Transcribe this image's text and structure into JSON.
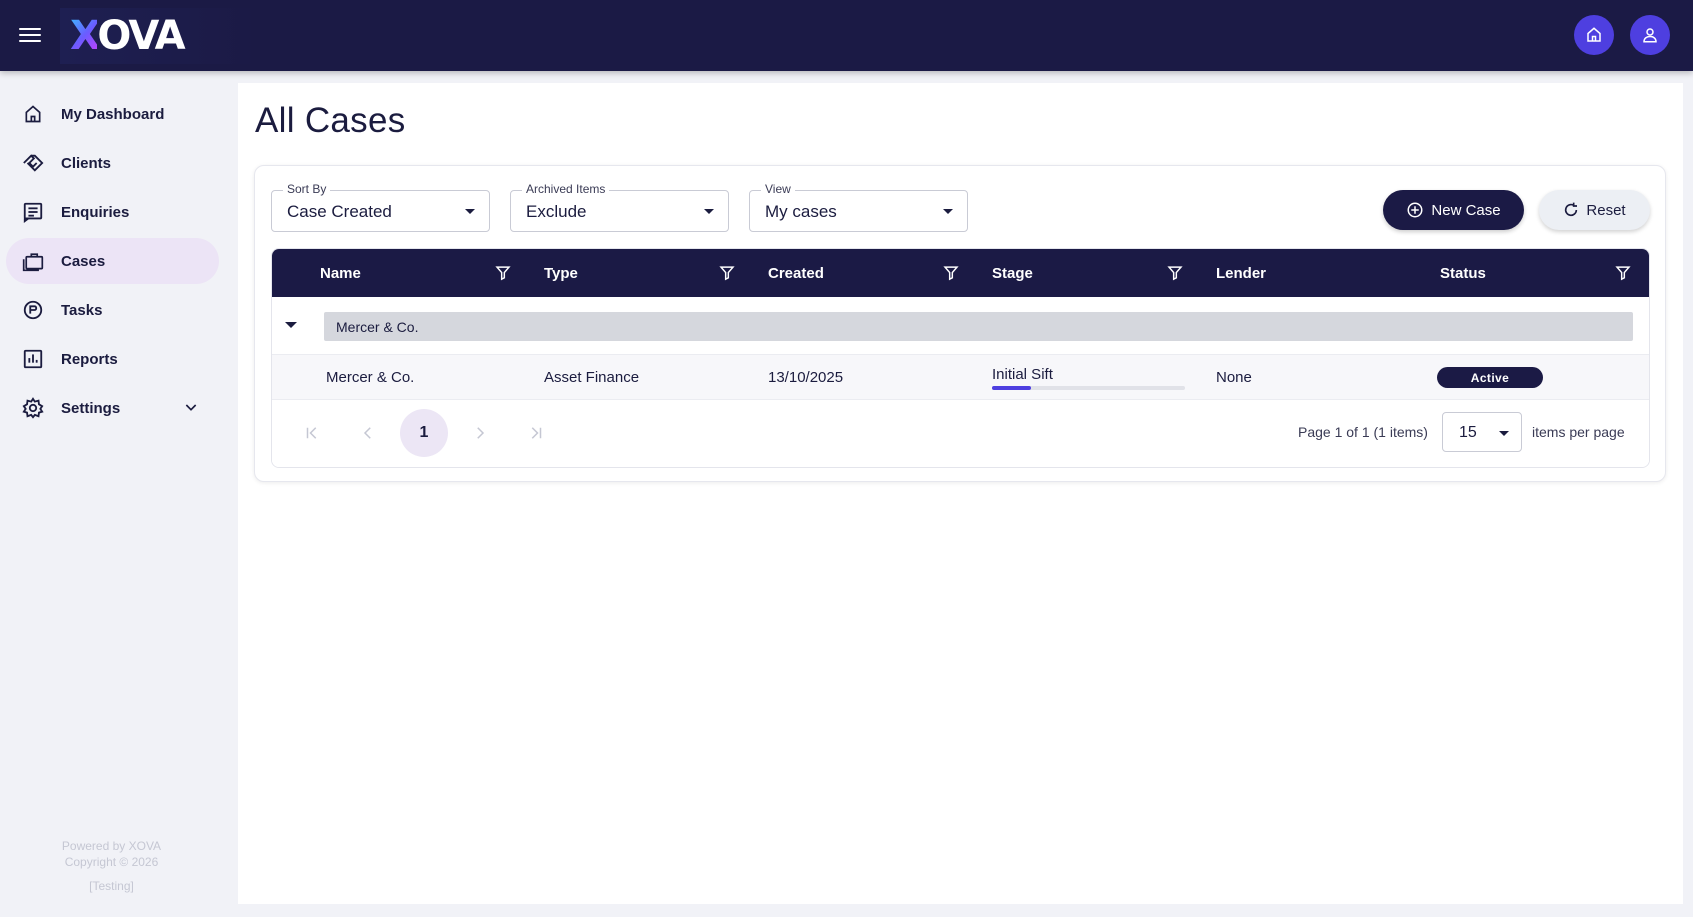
{
  "app": {
    "logo_prefix": "X",
    "logo_rest": "OVA"
  },
  "sidebar": {
    "items": [
      {
        "label": "My Dashboard",
        "icon": "home-icon"
      },
      {
        "label": "Clients",
        "icon": "handshake-icon"
      },
      {
        "label": "Enquiries",
        "icon": "list-icon"
      },
      {
        "label": "Cases",
        "icon": "briefcase-icon",
        "active": true
      },
      {
        "label": "Tasks",
        "icon": "tasks-icon"
      },
      {
        "label": "Reports",
        "icon": "bar-chart-icon"
      },
      {
        "label": "Settings",
        "icon": "gear-icon",
        "expandable": true
      }
    ],
    "footer": {
      "powered": "Powered by XOVA",
      "copyright": "Copyright © 2026",
      "env": "[Testing]"
    }
  },
  "main": {
    "title": "All Cases",
    "filters": {
      "sort_by": {
        "label": "Sort By",
        "value": "Case Created"
      },
      "archived": {
        "label": "Archived Items",
        "value": "Exclude"
      },
      "view": {
        "label": "View",
        "value": "My cases"
      }
    },
    "buttons": {
      "new_case": "New Case",
      "reset": "Reset"
    },
    "grid": {
      "columns": [
        "Name",
        "Type",
        "Created",
        "Stage",
        "Lender",
        "Status"
      ],
      "group": "Mercer & Co.",
      "rows": [
        {
          "name": "Mercer & Co.",
          "type": "Asset Finance",
          "created": "13/10/2025",
          "stage": "Initial Sift",
          "stage_progress": 0.2,
          "lender": "None",
          "status": "Active"
        }
      ]
    },
    "pager": {
      "current_page": "1",
      "info": "Page 1 of 1 (1 items)",
      "page_size": "15",
      "per_page_label": "items per page"
    }
  },
  "colors": {
    "navy": "#1b1a45",
    "accent": "#4e3fe0",
    "active_nav": "#ece4f6"
  }
}
